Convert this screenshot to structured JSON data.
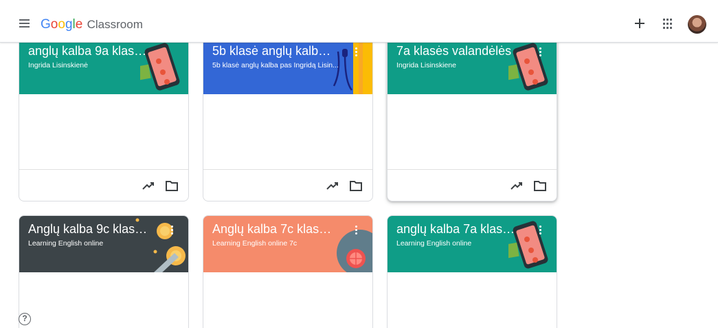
{
  "header": {
    "brand_letters": [
      "G",
      "o",
      "o",
      "g",
      "l",
      "e"
    ],
    "product": "Classroom",
    "icons": {
      "menu": "hamburger-menu-icon",
      "create": "plus-icon",
      "apps": "grid-apps-icon",
      "account": "avatar"
    }
  },
  "classes": [
    {
      "title": "anglų kalba 9a klasei ...",
      "subtitle": "Ingrida Lisinskienė",
      "color": "#0f9d87",
      "art": "phone"
    },
    {
      "title": "5b klasė anglų kalba ...",
      "subtitle": "5b klasė anglų kalba pas Ingridą Lisin...",
      "color": "#3367d6",
      "art": "headphones"
    },
    {
      "title": "7a klasės valandėlės",
      "subtitle": "Ingrida Lisinskiene",
      "color": "#0f9d87",
      "art": "phone"
    },
    {
      "title": "Anglų kalba 9c klasei ...",
      "subtitle": "Learning English online",
      "color": "#3c4448",
      "art": "coins"
    },
    {
      "title": "Anglų kalba 7c klasei ...",
      "subtitle": "Learning English online 7c",
      "color": "#f58b6b",
      "art": "bubble"
    },
    {
      "title": "anglų kalba 7a klasė ...",
      "subtitle": "Learning English online",
      "color": "#0f9d87",
      "art": "phone"
    }
  ],
  "help": {
    "label": "?"
  }
}
